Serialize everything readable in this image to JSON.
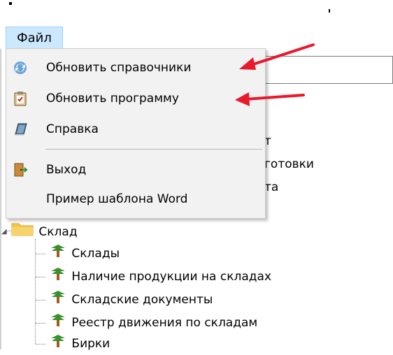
{
  "menubar": {
    "file_label": "Файл"
  },
  "file_menu": {
    "items": [
      {
        "label": "Обновить справочники",
        "icon": "refresh-icon"
      },
      {
        "label": "Обновить программу",
        "icon": "clipboard-check-icon"
      },
      {
        "label": "Справка",
        "icon": "help-book-icon"
      },
      {
        "label": "Выход",
        "icon": "exit-door-icon"
      },
      {
        "label": "Пример шаблона Word",
        "icon": ""
      }
    ]
  },
  "background": {
    "partial_texts": [
      "т",
      "готовки",
      "та"
    ]
  },
  "tree": {
    "folder": {
      "label": "Склад",
      "icon": "folder-icon"
    },
    "items": [
      {
        "label": "Склады",
        "icon": "tree-icon"
      },
      {
        "label": "Наличие продукции на складах",
        "icon": "tree-icon"
      },
      {
        "label": "Складские документы",
        "icon": "tree-icon"
      },
      {
        "label": "Реестр движения по складам",
        "icon": "tree-icon"
      },
      {
        "label": "Бирки",
        "icon": "tree-icon"
      }
    ]
  },
  "colors": {
    "menu_highlight": "#cce8ff",
    "menu_background": "#f2f2f2",
    "arrow": "#e8192c",
    "folder": "#f3c64f",
    "tree_icon": "#3a8f2e"
  }
}
